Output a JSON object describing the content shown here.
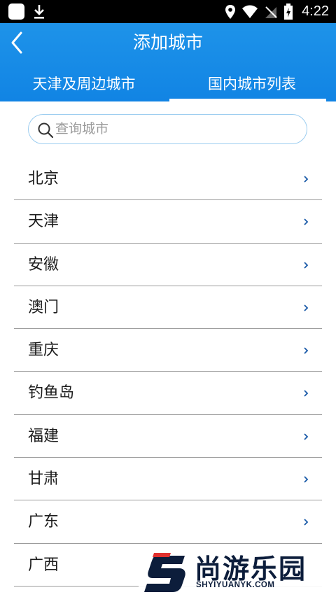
{
  "status_bar": {
    "time": "4:22"
  },
  "header": {
    "title": "添加城市",
    "tabs": [
      {
        "label": "天津及周边城市",
        "active": false
      },
      {
        "label": "国内城市列表",
        "active": true
      }
    ]
  },
  "search": {
    "placeholder": "查询城市"
  },
  "cities": [
    {
      "label": "北京"
    },
    {
      "label": "天津"
    },
    {
      "label": "安徽"
    },
    {
      "label": "澳门"
    },
    {
      "label": "重庆"
    },
    {
      "label": "钓鱼岛"
    },
    {
      "label": "福建"
    },
    {
      "label": "甘肃"
    },
    {
      "label": "广东"
    },
    {
      "label": "广西"
    }
  ],
  "watermark": {
    "name": "尚游乐园",
    "domain": "SHYIYUANYK.COM"
  },
  "colors": {
    "header": "#1184e4",
    "search_border": "#9ccdf0",
    "chevron": "#1a5aa8"
  }
}
